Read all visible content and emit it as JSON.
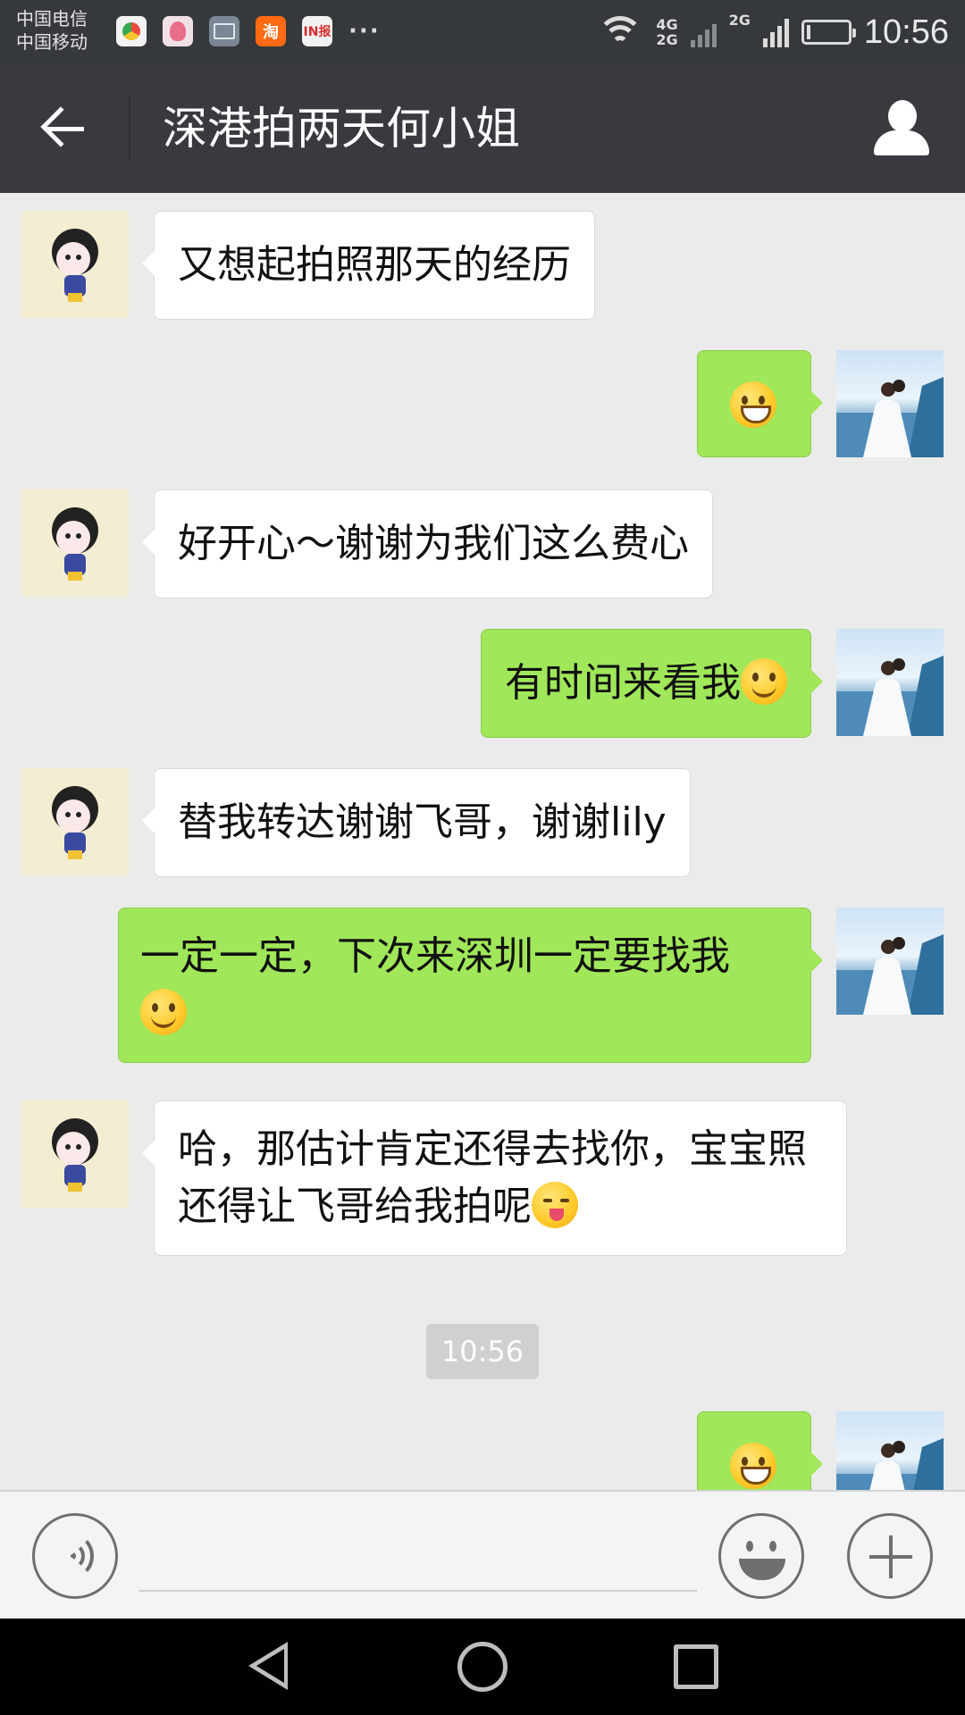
{
  "status_bar": {
    "carrier_1": "中国电信",
    "carrier_2": "中国移动",
    "notification_icons": [
      "browser-icon",
      "pink-app-icon",
      "gallery-icon",
      "taobao-icon",
      "news-icon"
    ],
    "taobao_label": "淘",
    "news_label": "IN报",
    "more_label": "···",
    "network_1": "4G",
    "network_2": "2G",
    "network_3": "2G",
    "battery_level": 0.1,
    "time": "10:56"
  },
  "header": {
    "title": "深港拍两天何小姐",
    "back_icon": "arrow-left-icon",
    "profile_icon": "person-icon"
  },
  "messages": [
    {
      "side": "left",
      "text": "又想起拍照那天的经历",
      "emoji": null
    },
    {
      "side": "right",
      "text": "",
      "emoji": "grinning-face"
    },
    {
      "side": "left",
      "text": "好开心～谢谢为我们这么费心",
      "emoji": null
    },
    {
      "side": "right",
      "text": "有时间来看我",
      "emoji": "smiling-face"
    },
    {
      "side": "left",
      "text": "替我转达谢谢飞哥，谢谢lily",
      "emoji": null
    },
    {
      "side": "right",
      "text": "一定一定，下次来深圳一定要找我",
      "emoji": "smiling-face"
    },
    {
      "side": "left",
      "text": "哈，那估计肯定还得去找你，宝宝照还得让飞哥给我拍呢",
      "emoji": "winking-tongue-face"
    },
    {
      "side": "right",
      "text": "",
      "emoji": "big-grin-face"
    }
  ],
  "timestamp": "10:56",
  "input_bar": {
    "voice_icon": "voice-icon",
    "input_value": "",
    "emoji_icon": "smiley-icon",
    "plus_icon": "plus-icon"
  },
  "nav_bar": {
    "icons": [
      "nav-back-icon",
      "nav-home-icon",
      "nav-recents-icon"
    ]
  },
  "colors": {
    "status_bar": "#36393c",
    "title_bar": "#393a3f",
    "chat_background": "#ebebeb",
    "sent_bubble": "#a0e75a",
    "received_bubble": "#ffffff"
  }
}
